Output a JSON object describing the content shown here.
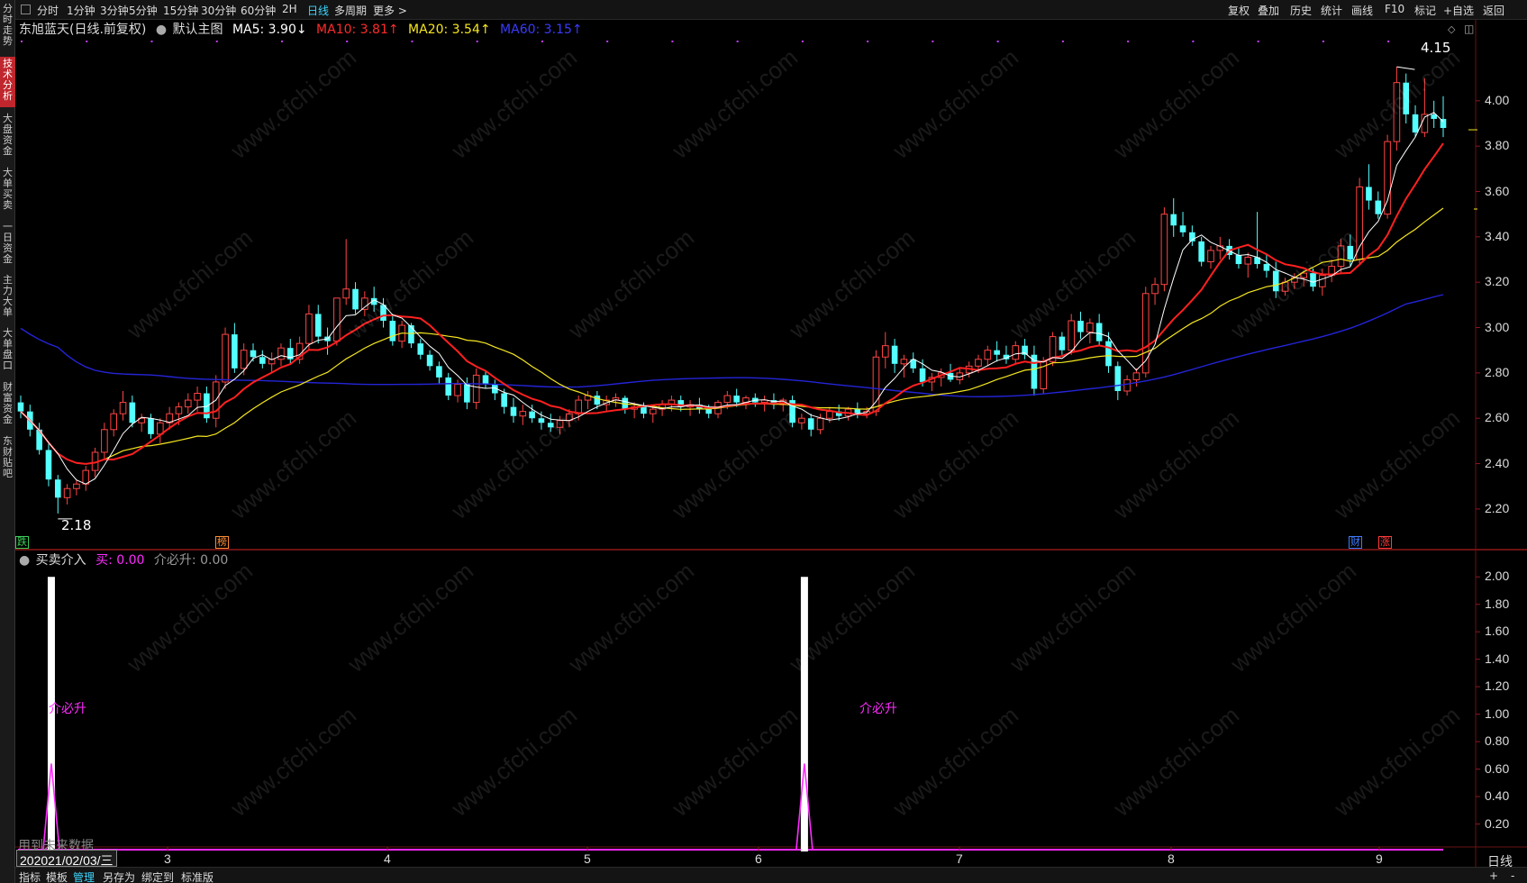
{
  "toolbar": {
    "timeframes": [
      "分时",
      "1分钟",
      "3分钟",
      "5分钟",
      "15分钟",
      "30分钟",
      "60分钟",
      "2H",
      "日线",
      "多周期",
      "更多 >"
    ],
    "active_timeframe": "日线",
    "right_items": [
      "复权",
      "叠加",
      "历史",
      "统计",
      "画线",
      "F10",
      "标记",
      "+自选",
      "返回"
    ]
  },
  "left_tabs": [
    "分时走势",
    "技术分析",
    "大盘资金",
    "大单买卖",
    "一日资金",
    "主力大单",
    "大单盘口",
    "财富资金",
    "东财贴吧"
  ],
  "active_left_tab": "技术分析",
  "main_legend": {
    "title": "东旭蓝天(日线.前复权)",
    "template": "默认主图",
    "ma5": "MA5: 3.90↓",
    "ma10": "MA10: 3.81↑",
    "ma20": "MA20: 3.54↑",
    "ma60": "MA60: 3.15↑"
  },
  "sub_legend": {
    "title": "买卖介入",
    "buy": "买: 0.00",
    "rise": "介必升: 0.00"
  },
  "colors": {
    "up": "#ff4444",
    "down": "#54ffff",
    "ma5": "#ffffff",
    "ma10": "#ff2020",
    "ma20": "#f5e620",
    "ma60": "#2424d8",
    "signal": "#ff2bff",
    "bar": "#ffffff"
  },
  "main_y_labels": [
    "4.00",
    "3.80",
    "3.60",
    "3.40",
    "3.20",
    "3.00",
    "2.80",
    "2.60",
    "2.40",
    "2.20"
  ],
  "sub_y_labels": [
    "2.00",
    "1.80",
    "1.60",
    "1.40",
    "1.20",
    "1.00",
    "0.80",
    "0.60",
    "0.40",
    "0.20"
  ],
  "x_labels": [
    "3",
    "4",
    "5",
    "6",
    "7",
    "8",
    "9"
  ],
  "cursor_date": "2021/02/03/三",
  "cursor_prefix": "20",
  "period_label": "日线",
  "high_label": "4.15",
  "low_label": "2.18",
  "event_markers": [
    {
      "label": "跌",
      "color": "#3ccf5a"
    },
    {
      "label": "榜",
      "color": "#ff8c33"
    },
    {
      "label": "财",
      "color": "#3d7bff"
    },
    {
      "label": "涨",
      "color": "#ff3b3b"
    }
  ],
  "signal_text": "介必升",
  "overlay_text": "用到未来数据",
  "bottom_bar": [
    "指标",
    "模板",
    "管理",
    "另存为",
    "绑定到",
    "标准版"
  ],
  "bottom_active": "管理",
  "bottom_right": [
    "+",
    "-"
  ],
  "watermark": "www.cfchi.com",
  "chart_data": {
    "type": "candlestick",
    "y_range": [
      2.14,
      4.19
    ],
    "sub_y_range": [
      0,
      2.1
    ],
    "candles": [
      [
        2.67,
        2.7,
        2.6,
        2.63
      ],
      [
        2.63,
        2.66,
        2.52,
        2.55
      ],
      [
        2.55,
        2.58,
        2.44,
        2.46
      ],
      [
        2.46,
        2.49,
        2.3,
        2.33
      ],
      [
        2.33,
        2.35,
        2.18,
        2.25
      ],
      [
        2.25,
        2.31,
        2.22,
        2.29
      ],
      [
        2.29,
        2.33,
        2.26,
        2.31
      ],
      [
        2.31,
        2.39,
        2.28,
        2.37
      ],
      [
        2.37,
        2.47,
        2.34,
        2.45
      ],
      [
        2.45,
        2.58,
        2.42,
        2.55
      ],
      [
        2.55,
        2.64,
        2.52,
        2.62
      ],
      [
        2.62,
        2.72,
        2.59,
        2.67
      ],
      [
        2.67,
        2.7,
        2.56,
        2.58
      ],
      [
        2.58,
        2.62,
        2.54,
        2.6
      ],
      [
        2.6,
        2.62,
        2.51,
        2.53
      ],
      [
        2.53,
        2.6,
        2.49,
        2.58
      ],
      [
        2.58,
        2.65,
        2.55,
        2.62
      ],
      [
        2.62,
        2.67,
        2.57,
        2.65
      ],
      [
        2.65,
        2.71,
        2.62,
        2.68
      ],
      [
        2.68,
        2.74,
        2.63,
        2.71
      ],
      [
        2.71,
        2.74,
        2.58,
        2.6
      ],
      [
        2.6,
        2.79,
        2.56,
        2.76
      ],
      [
        2.76,
        3.0,
        2.73,
        2.97
      ],
      [
        2.97,
        3.02,
        2.8,
        2.82
      ],
      [
        2.82,
        2.93,
        2.79,
        2.9
      ],
      [
        2.9,
        2.93,
        2.85,
        2.87
      ],
      [
        2.87,
        2.9,
        2.82,
        2.84
      ],
      [
        2.84,
        2.89,
        2.8,
        2.86
      ],
      [
        2.86,
        2.93,
        2.83,
        2.91
      ],
      [
        2.91,
        2.95,
        2.84,
        2.86
      ],
      [
        2.86,
        2.96,
        2.84,
        2.93
      ],
      [
        2.93,
        3.1,
        2.9,
        3.06
      ],
      [
        3.06,
        3.1,
        2.93,
        2.96
      ],
      [
        2.96,
        3.0,
        2.88,
        2.94
      ],
      [
        2.94,
        3.13,
        2.92,
        3.13
      ],
      [
        3.13,
        3.39,
        3.1,
        3.17
      ],
      [
        3.17,
        3.2,
        3.06,
        3.08
      ],
      [
        3.08,
        3.16,
        3.05,
        3.13
      ],
      [
        3.13,
        3.18,
        3.07,
        3.1
      ],
      [
        3.1,
        3.13,
        3.0,
        3.03
      ],
      [
        3.03,
        3.06,
        2.92,
        2.94
      ],
      [
        2.94,
        3.03,
        2.91,
        3.01
      ],
      [
        3.01,
        3.02,
        2.91,
        2.93
      ],
      [
        2.93,
        2.95,
        2.86,
        2.88
      ],
      [
        2.88,
        2.9,
        2.81,
        2.83
      ],
      [
        2.83,
        2.85,
        2.75,
        2.78
      ],
      [
        2.78,
        2.8,
        2.68,
        2.7
      ],
      [
        2.7,
        2.77,
        2.67,
        2.75
      ],
      [
        2.75,
        2.78,
        2.64,
        2.67
      ],
      [
        2.67,
        2.82,
        2.64,
        2.79
      ],
      [
        2.79,
        2.81,
        2.73,
        2.75
      ],
      [
        2.75,
        2.77,
        2.68,
        2.71
      ],
      [
        2.71,
        2.73,
        2.62,
        2.65
      ],
      [
        2.65,
        2.69,
        2.58,
        2.61
      ],
      [
        2.61,
        2.66,
        2.57,
        2.63
      ],
      [
        2.63,
        2.66,
        2.58,
        2.6
      ],
      [
        2.6,
        2.63,
        2.55,
        2.58
      ],
      [
        2.58,
        2.62,
        2.54,
        2.56
      ],
      [
        2.56,
        2.61,
        2.53,
        2.59
      ],
      [
        2.59,
        2.64,
        2.56,
        2.62
      ],
      [
        2.62,
        2.7,
        2.59,
        2.68
      ],
      [
        2.68,
        2.72,
        2.64,
        2.7
      ],
      [
        2.7,
        2.72,
        2.64,
        2.66
      ],
      [
        2.66,
        2.7,
        2.63,
        2.68
      ],
      [
        2.68,
        2.71,
        2.65,
        2.69
      ],
      [
        2.69,
        2.7,
        2.62,
        2.64
      ],
      [
        2.64,
        2.67,
        2.6,
        2.65
      ],
      [
        2.65,
        2.67,
        2.6,
        2.62
      ],
      [
        2.62,
        2.66,
        2.58,
        2.64
      ],
      [
        2.64,
        2.68,
        2.61,
        2.66
      ],
      [
        2.66,
        2.7,
        2.63,
        2.68
      ],
      [
        2.68,
        2.7,
        2.63,
        2.65
      ],
      [
        2.65,
        2.68,
        2.61,
        2.66
      ],
      [
        2.66,
        2.69,
        2.62,
        2.64
      ],
      [
        2.64,
        2.66,
        2.6,
        2.62
      ],
      [
        2.62,
        2.68,
        2.6,
        2.67
      ],
      [
        2.67,
        2.72,
        2.64,
        2.7
      ],
      [
        2.7,
        2.73,
        2.65,
        2.67
      ],
      [
        2.67,
        2.7,
        2.64,
        2.69
      ],
      [
        2.69,
        2.71,
        2.65,
        2.67
      ],
      [
        2.67,
        2.7,
        2.63,
        2.68
      ],
      [
        2.68,
        2.71,
        2.64,
        2.66
      ],
      [
        2.66,
        2.69,
        2.63,
        2.68
      ],
      [
        2.68,
        2.7,
        2.56,
        2.58
      ],
      [
        2.58,
        2.62,
        2.55,
        2.6
      ],
      [
        2.6,
        2.62,
        2.52,
        2.55
      ],
      [
        2.55,
        2.62,
        2.53,
        2.6
      ],
      [
        2.6,
        2.65,
        2.58,
        2.63
      ],
      [
        2.63,
        2.66,
        2.59,
        2.61
      ],
      [
        2.61,
        2.65,
        2.59,
        2.64
      ],
      [
        2.64,
        2.67,
        2.6,
        2.62
      ],
      [
        2.62,
        2.65,
        2.6,
        2.63
      ],
      [
        2.63,
        2.9,
        2.61,
        2.87
      ],
      [
        2.87,
        2.98,
        2.82,
        2.92
      ],
      [
        2.92,
        2.95,
        2.8,
        2.84
      ],
      [
        2.84,
        2.88,
        2.78,
        2.86
      ],
      [
        2.86,
        2.89,
        2.8,
        2.82
      ],
      [
        2.82,
        2.86,
        2.74,
        2.76
      ],
      [
        2.76,
        2.8,
        2.72,
        2.78
      ],
      [
        2.78,
        2.82,
        2.74,
        2.8
      ],
      [
        2.8,
        2.84,
        2.76,
        2.77
      ],
      [
        2.77,
        2.82,
        2.75,
        2.8
      ],
      [
        2.8,
        2.85,
        2.78,
        2.83
      ],
      [
        2.83,
        2.88,
        2.8,
        2.86
      ],
      [
        2.86,
        2.92,
        2.83,
        2.9
      ],
      [
        2.9,
        2.94,
        2.85,
        2.88
      ],
      [
        2.88,
        2.92,
        2.84,
        2.86
      ],
      [
        2.86,
        2.94,
        2.84,
        2.92
      ],
      [
        2.92,
        2.95,
        2.86,
        2.88
      ],
      [
        2.88,
        2.92,
        2.7,
        2.73
      ],
      [
        2.73,
        2.87,
        2.71,
        2.85
      ],
      [
        2.85,
        2.98,
        2.83,
        2.96
      ],
      [
        2.96,
        2.98,
        2.88,
        2.9
      ],
      [
        2.9,
        3.06,
        2.88,
        3.03
      ],
      [
        3.03,
        3.07,
        2.95,
        2.98
      ],
      [
        2.98,
        3.04,
        2.93,
        3.02
      ],
      [
        3.02,
        3.06,
        2.92,
        2.94
      ],
      [
        2.94,
        2.98,
        2.8,
        2.83
      ],
      [
        2.83,
        2.85,
        2.68,
        2.72
      ],
      [
        2.72,
        2.79,
        2.7,
        2.77
      ],
      [
        2.77,
        2.82,
        2.74,
        2.8
      ],
      [
        2.8,
        3.18,
        2.78,
        3.15
      ],
      [
        3.15,
        3.22,
        3.1,
        3.19
      ],
      [
        3.19,
        3.53,
        3.16,
        3.5
      ],
      [
        3.5,
        3.57,
        3.4,
        3.45
      ],
      [
        3.45,
        3.51,
        3.4,
        3.42
      ],
      [
        3.42,
        3.45,
        3.36,
        3.38
      ],
      [
        3.38,
        3.4,
        3.27,
        3.29
      ],
      [
        3.29,
        3.36,
        3.26,
        3.34
      ],
      [
        3.34,
        3.4,
        3.3,
        3.36
      ],
      [
        3.36,
        3.39,
        3.3,
        3.32
      ],
      [
        3.32,
        3.35,
        3.26,
        3.28
      ],
      [
        3.28,
        3.33,
        3.22,
        3.31
      ],
      [
        3.31,
        3.51,
        3.26,
        3.28
      ],
      [
        3.28,
        3.32,
        3.22,
        3.25
      ],
      [
        3.25,
        3.29,
        3.13,
        3.16
      ],
      [
        3.16,
        3.22,
        3.14,
        3.2
      ],
      [
        3.2,
        3.24,
        3.17,
        3.22
      ],
      [
        3.22,
        3.25,
        3.18,
        3.24
      ],
      [
        3.24,
        3.26,
        3.16,
        3.18
      ],
      [
        3.18,
        3.26,
        3.14,
        3.23
      ],
      [
        3.23,
        3.3,
        3.2,
        3.27
      ],
      [
        3.27,
        3.39,
        3.24,
        3.36
      ],
      [
        3.36,
        3.41,
        3.27,
        3.3
      ],
      [
        3.3,
        3.66,
        3.28,
        3.62
      ],
      [
        3.62,
        3.72,
        3.52,
        3.56
      ],
      [
        3.56,
        3.6,
        3.48,
        3.5
      ],
      [
        3.5,
        3.85,
        3.48,
        3.82
      ],
      [
        3.82,
        4.15,
        3.78,
        4.08
      ],
      [
        4.08,
        4.12,
        3.9,
        3.94
      ],
      [
        3.94,
        3.98,
        3.84,
        3.86
      ],
      [
        3.86,
        4.1,
        3.84,
        3.94
      ],
      [
        3.94,
        4.0,
        3.88,
        3.92
      ],
      [
        3.92,
        4.02,
        3.84,
        3.88
      ]
    ],
    "signals": [
      {
        "index": 3,
        "value": 2.0,
        "peak": 0.64
      },
      {
        "index": 84,
        "value": 2.0,
        "peak": 0.64
      }
    ]
  }
}
